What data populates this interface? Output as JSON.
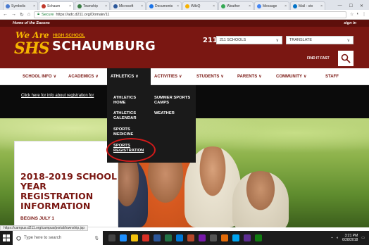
{
  "browser": {
    "tabs": [
      {
        "label": "Symbolic",
        "color": "#4a7bd0",
        "active": false
      },
      {
        "label": "Schaum",
        "color": "#c0392b",
        "active": true
      },
      {
        "label": "Township",
        "color": "#3a7d44",
        "active": false
      },
      {
        "label": "Microsoft",
        "color": "#2b579a",
        "active": false
      },
      {
        "label": "Documents",
        "color": "#1a73e8",
        "active": false
      },
      {
        "label": "WikiQ",
        "color": "#f6b100",
        "active": false
      },
      {
        "label": "Weather",
        "color": "#34a853",
        "active": false
      },
      {
        "label": "Message",
        "color": "#4285f4",
        "active": false
      },
      {
        "label": "Mail - sto",
        "color": "#0072c6",
        "active": false
      }
    ],
    "window_controls": [
      "—",
      "☐",
      "✕"
    ],
    "address": {
      "secure_label": "Secure",
      "url": "https://adc.d211.org/Domain/11"
    }
  },
  "site": {
    "top_strip_left": "Home of the Saxons",
    "top_strip_right": "sign in",
    "logo_top": "We Are",
    "logo_main": "SHS",
    "school_name": "SCHAUMBURG",
    "school_sub": "HIGH SCHOOL",
    "district_logo": "211",
    "schools_dropdown": "211 SCHOOLS",
    "translate_dropdown": "TRANSLATE",
    "find_it_fast": "FIND IT FAST",
    "accent": "#7a1712",
    "gold": "#f5b400"
  },
  "nav": {
    "items": [
      {
        "label": "SCHOOL INFO"
      },
      {
        "label": "ACADEMICS"
      },
      {
        "label": "ATHLETICS"
      },
      {
        "label": "ACTIVITIES"
      },
      {
        "label": "STUDENTS"
      },
      {
        "label": "PARENTS"
      },
      {
        "label": "COMMUNITY"
      },
      {
        "label": "STAFF"
      }
    ]
  },
  "dropdown": {
    "athletics_home": "ATHLETICS HOME",
    "athletics_calendar": "ATHLETICS CALENDAR",
    "sports_medicine": "SPORTS MEDICINE",
    "sports_registration": "SPORTS REGISTRATION",
    "summer_camps": "SUMMER SPORTS CAMPS",
    "weather": "WEATHER"
  },
  "content": {
    "reg_link": "Click here for info about registration for",
    "hero_title": "2018-2019 SCHOOL YEAR REGISTRATION INFORMATION",
    "hero_sub": "BEGINS JULY 1"
  },
  "status_url": "https://campus.d211.org/campus/portal/township.jsp",
  "taskbar": {
    "search_placeholder": "Type here to search",
    "time": "3:21 PM",
    "date": "6/28/2018"
  }
}
